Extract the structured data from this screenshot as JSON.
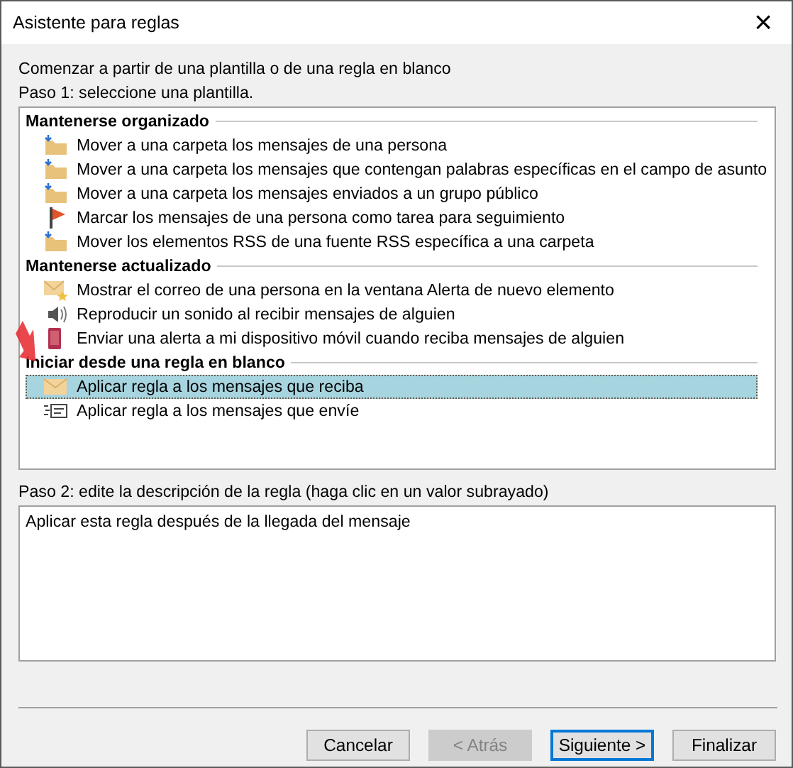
{
  "window": {
    "title": "Asistente para reglas",
    "close": "×"
  },
  "intro": "Comenzar a partir de una plantilla o de una regla en blanco",
  "step1": "Paso 1: seleccione una plantilla.",
  "groups": [
    {
      "title": "Mantenerse organizado",
      "items": [
        {
          "label": "Mover a una carpeta los mensajes de una persona",
          "kind": "folder",
          "selected": false
        },
        {
          "label": "Mover a una carpeta los mensajes que contengan palabras específicas en el campo de asunto",
          "kind": "folder",
          "selected": false
        },
        {
          "label": "Mover a una carpeta los mensajes enviados a un grupo público",
          "kind": "folder",
          "selected": false
        },
        {
          "label": "Marcar los mensajes de una persona como tarea para seguimiento",
          "kind": "flag",
          "selected": false
        },
        {
          "label": "Mover los elementos RSS de una fuente RSS específica a una carpeta",
          "kind": "folder",
          "selected": false
        }
      ]
    },
    {
      "title": "Mantenerse actualizado",
      "items": [
        {
          "label": "Mostrar el correo de una persona en la ventana Alerta de nuevo elemento",
          "kind": "alert",
          "selected": false
        },
        {
          "label": "Reproducir un sonido al recibir mensajes de alguien",
          "kind": "sound",
          "selected": false
        },
        {
          "label": "Enviar una alerta a mi dispositivo móvil cuando reciba mensajes de alguien",
          "kind": "mobile",
          "selected": false
        }
      ]
    },
    {
      "title": "Iniciar desde una regla en blanco",
      "items": [
        {
          "label": "Aplicar regla a los mensajes que reciba",
          "kind": "envelope",
          "selected": true
        },
        {
          "label": "Aplicar regla a los mensajes que envíe",
          "kind": "send",
          "selected": false
        }
      ]
    }
  ],
  "step2": "Paso 2: edite la descripción de la regla (haga clic en un valor subrayado)",
  "description": "Aplicar esta regla después de la llegada del mensaje",
  "buttons": [
    {
      "label": "Cancelar",
      "disabled": false,
      "default": false
    },
    {
      "label": "< Atrás",
      "disabled": true,
      "default": false
    },
    {
      "label": "Siguiente >",
      "disabled": false,
      "default": true
    },
    {
      "label": "Finalizar",
      "disabled": false,
      "default": false
    }
  ]
}
